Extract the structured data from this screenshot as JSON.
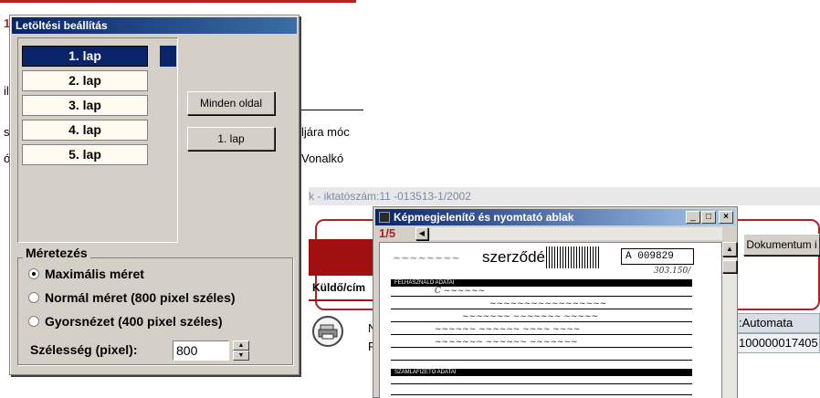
{
  "background_app": {
    "frag_1": "1",
    "frag_s": "s",
    "frag_il": "il",
    "frag_o": "ó",
    "frag_method": "ljára móc",
    "frag_barcode": "Vonalkó",
    "frag_iktato": "k - iktatószám:11     -013513-1/2002",
    "sender_label": "Küldő/cím",
    "doc_button": "Dokumentum i",
    "r_char": "R",
    "n_char": "N",
    "automata": ":Automata",
    "code": "100000017405"
  },
  "download_dialog": {
    "title": "Letöltési beállítás",
    "pages": [
      {
        "label": "1. lap",
        "selected": true
      },
      {
        "label": "2. lap",
        "selected": false
      },
      {
        "label": "3. lap",
        "selected": false
      },
      {
        "label": "4. lap",
        "selected": false
      },
      {
        "label": "5. lap",
        "selected": false
      }
    ],
    "all_pages_button": "Minden oldal",
    "first_page_button": "1. lap",
    "sizing_group": "Méretezés",
    "options": [
      {
        "label": "Maximális méret",
        "checked": true
      },
      {
        "label": "Normál méret (800 pixel széles)",
        "checked": false
      },
      {
        "label": "Gyorsnézet (400 pixel széles)",
        "checked": false
      }
    ],
    "width_label": "Szélesség (pixel):",
    "width_value": "800"
  },
  "viewer": {
    "title": "Képmegjelenítő és nyomtató ablak",
    "page_indicator": "1/5",
    "minimize": "_",
    "maximize": "□",
    "close": "×",
    "doc_heading": "szerződés",
    "doc_number_prefix": "A",
    "doc_number": "009829",
    "section_1": "FELHASZNÁLÓ ADATAI",
    "section_2": "SZÁMLAFIZETŐ ADATAI"
  }
}
